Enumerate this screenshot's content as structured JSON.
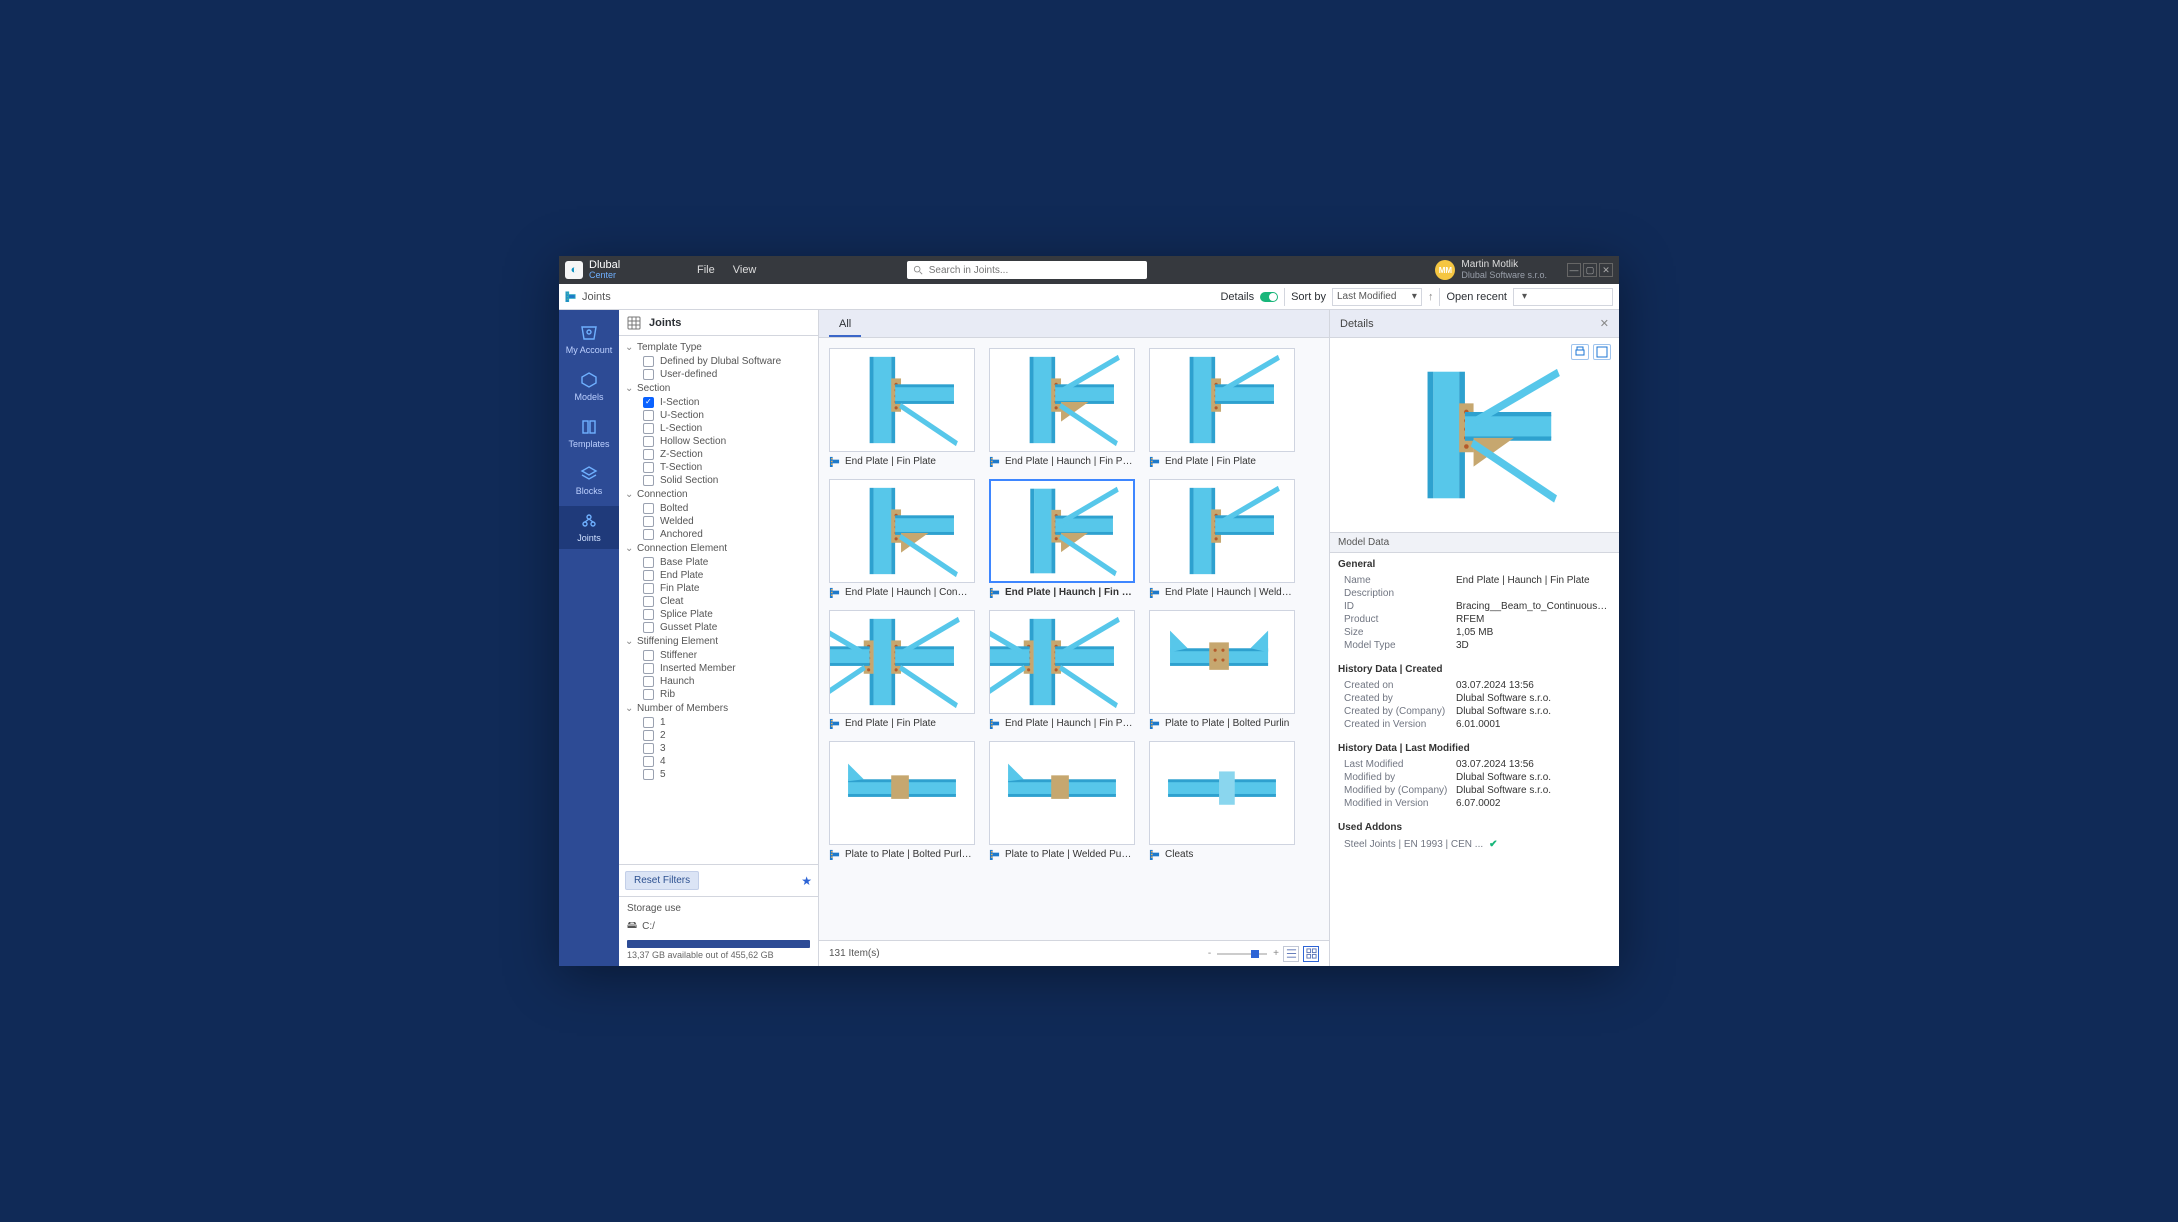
{
  "brand": {
    "name": "Dlubal",
    "sub": "Center"
  },
  "menu": {
    "file": "File",
    "view": "View"
  },
  "search": {
    "placeholder": "Search in Joints..."
  },
  "user": {
    "initials": "MM",
    "name": "Martin Motlik",
    "company": "Dlubal Software s.r.o."
  },
  "leftnav": [
    {
      "label": "My Account"
    },
    {
      "label": "Models"
    },
    {
      "label": "Templates"
    },
    {
      "label": "Blocks"
    },
    {
      "label": "Joints"
    }
  ],
  "breadcrumb": "Joints",
  "subbar": {
    "details": "Details",
    "sortby": "Sort by",
    "sortval": "Last Modified",
    "open": "Open recent"
  },
  "filters_title": "Joints",
  "filters": [
    {
      "title": "Template Type",
      "items": [
        {
          "label": "Defined by Dlubal Software",
          "checked": false
        },
        {
          "label": "User-defined",
          "checked": false
        }
      ]
    },
    {
      "title": "Section",
      "items": [
        {
          "label": "I-Section",
          "checked": true
        },
        {
          "label": "U-Section",
          "checked": false
        },
        {
          "label": "L-Section",
          "checked": false
        },
        {
          "label": "Hollow Section",
          "checked": false
        },
        {
          "label": "Z-Section",
          "checked": false
        },
        {
          "label": "T-Section",
          "checked": false
        },
        {
          "label": "Solid Section",
          "checked": false
        }
      ]
    },
    {
      "title": "Connection",
      "items": [
        {
          "label": "Bolted",
          "checked": false
        },
        {
          "label": "Welded",
          "checked": false
        },
        {
          "label": "Anchored",
          "checked": false
        }
      ]
    },
    {
      "title": "Connection Element",
      "items": [
        {
          "label": "Base Plate",
          "checked": false
        },
        {
          "label": "End Plate",
          "checked": false
        },
        {
          "label": "Fin Plate",
          "checked": false
        },
        {
          "label": "Cleat",
          "checked": false
        },
        {
          "label": "Splice Plate",
          "checked": false
        },
        {
          "label": "Gusset Plate",
          "checked": false
        }
      ]
    },
    {
      "title": "Stiffening Element",
      "items": [
        {
          "label": "Stiffener",
          "checked": false
        },
        {
          "label": "Inserted Member",
          "checked": false
        },
        {
          "label": "Haunch",
          "checked": false
        },
        {
          "label": "Rib",
          "checked": false
        }
      ]
    },
    {
      "title": "Number of Members",
      "items": [
        {
          "label": "1",
          "checked": false
        },
        {
          "label": "2",
          "checked": false
        },
        {
          "label": "3",
          "checked": false
        },
        {
          "label": "4",
          "checked": false
        },
        {
          "label": "5",
          "checked": false
        }
      ]
    }
  ],
  "reset": "Reset Filters",
  "storage": {
    "title": "Storage use",
    "drive": "C:/",
    "caption": "13,37 GB available out of 455,62 GB"
  },
  "tab": "All",
  "cards": [
    {
      "label": "End Plate | Fin Plate",
      "shape": "A"
    },
    {
      "label": "End Plate | Haunch | Fin Plate",
      "shape": "B"
    },
    {
      "label": "End Plate | Fin Plate",
      "shape": "C"
    },
    {
      "label": "End Plate | Haunch | Connec...",
      "shape": "D"
    },
    {
      "label": "End Plate | Haunch | Fin Pl...",
      "shape": "B",
      "selected": true
    },
    {
      "label": "End Plate | Haunch | Welded ...",
      "shape": "C"
    },
    {
      "label": "End Plate | Fin Plate",
      "shape": "E"
    },
    {
      "label": "End Plate | Haunch | Fin Plate",
      "shape": "E"
    },
    {
      "label": "Plate to Plate | Bolted Purlin",
      "shape": "F"
    },
    {
      "label": "Plate to Plate | Bolted Purlin ...",
      "shape": "G"
    },
    {
      "label": "Plate to Plate | Welded Purli...",
      "shape": "G"
    },
    {
      "label": "Cleats",
      "shape": "H"
    }
  ],
  "status": {
    "count": "131 Item(s)"
  },
  "details": {
    "title": "Details",
    "model_data": "Model Data",
    "groups": [
      {
        "title": "General",
        "rows": [
          {
            "k": "Name",
            "v": "End Plate | Haunch | Fin Plate"
          },
          {
            "k": "Description",
            "v": ""
          },
          {
            "k": "ID",
            "v": "Bracing__Beam_to_Continuous_Co..."
          },
          {
            "k": "Product",
            "v": "RFEM"
          },
          {
            "k": "Size",
            "v": "1,05 MB"
          },
          {
            "k": "Model Type",
            "v": "3D"
          }
        ]
      },
      {
        "title": "History Data | Created",
        "rows": [
          {
            "k": "Created on",
            "v": "03.07.2024 13:56"
          },
          {
            "k": "Created by",
            "v": "Dlubal Software s.r.o."
          },
          {
            "k": "Created by (Company)",
            "v": "Dlubal Software s.r.o."
          },
          {
            "k": "Created in Version",
            "v": "6.01.0001"
          }
        ]
      },
      {
        "title": "History Data | Last Modified",
        "rows": [
          {
            "k": "Last Modified",
            "v": "03.07.2024 13:56"
          },
          {
            "k": "Modified by",
            "v": "Dlubal Software s.r.o."
          },
          {
            "k": "Modified by (Company)",
            "v": "Dlubal Software s.r.o."
          },
          {
            "k": "Modified in Version",
            "v": "6.07.0002"
          }
        ]
      }
    ],
    "addons_title": "Used Addons",
    "addons": [
      "Steel Joints | EN 1993 | CEN ..."
    ]
  }
}
